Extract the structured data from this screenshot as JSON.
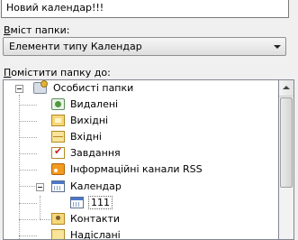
{
  "folder_name": {
    "value": "Новий календар!!!"
  },
  "folder_content": {
    "label_prefix": "В",
    "label_rest": "міст папки:",
    "selected": "Елементи типу Календар"
  },
  "location": {
    "label_prefix": "П",
    "label_rest": "омістити папку до:"
  },
  "tree": {
    "root": {
      "label": "Особисті папки",
      "icon": "personal-folders-icon",
      "expanded": true
    },
    "items": [
      {
        "label": "Видалені",
        "icon": "deleted-items-icon"
      },
      {
        "label": "Вихідні",
        "icon": "outbox-icon"
      },
      {
        "label": "Вхідні",
        "icon": "inbox-icon"
      },
      {
        "label": "Завдання",
        "icon": "tasks-icon"
      },
      {
        "label": "Інформаційні канали RSS",
        "icon": "rss-icon"
      },
      {
        "label": "Календар",
        "icon": "calendar-icon",
        "expanded": true
      },
      {
        "label": "111",
        "icon": "calendar-icon",
        "selected": true
      },
      {
        "label": "Контакти",
        "icon": "contacts-icon"
      },
      {
        "label": "Надіслані",
        "icon": "sent-items-icon"
      }
    ]
  }
}
